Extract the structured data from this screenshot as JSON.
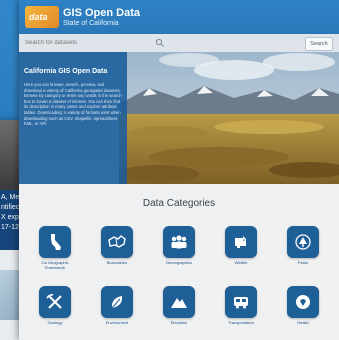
{
  "site": {
    "title": "GIS Open Data",
    "subtitle": "State of California",
    "logo_text": "data"
  },
  "search": {
    "placeholder": "Search for datasets",
    "button_label": "Search"
  },
  "hero": {
    "heading": "California GIS Open Data",
    "body": "Here you can browse, search, preview, and download a variety of California geospatial datasets. Browse by category or enter any words in the search box to locate a dataset of interest. You can then find its description in many cases and explore attribute tables. Downloading: A variety of formats exist when downloading such as CSV, shapefile, spreadsheet, KML, or API."
  },
  "background_window": {
    "lines": [
      "A, Me",
      "ntifiec",
      "X exp",
      "17-12"
    ]
  },
  "categories": {
    "title": "Data Categories",
    "items": [
      {
        "label": "CA Geographic Framework",
        "icon": "california-icon"
      },
      {
        "label": "Boundaries",
        "icon": "boundaries-icon"
      },
      {
        "label": "Demographics",
        "icon": "people-icon"
      },
      {
        "label": "Wildlife",
        "icon": "wildlife-icon"
      },
      {
        "label": "Parks",
        "icon": "parks-icon"
      },
      {
        "label": "Geology",
        "icon": "pickaxe-icon"
      },
      {
        "label": "Environment",
        "icon": "leaf-icon"
      },
      {
        "label": "Elevation",
        "icon": "mountain-icon"
      },
      {
        "label": "Transportation",
        "icon": "bus-icon"
      },
      {
        "label": "Health",
        "icon": "health-icon"
      }
    ]
  },
  "colors": {
    "header": "#2f82c6",
    "tile": "#1f5f98",
    "hero_panel": "#195c9b",
    "page_bg": "#1f6fb1"
  }
}
